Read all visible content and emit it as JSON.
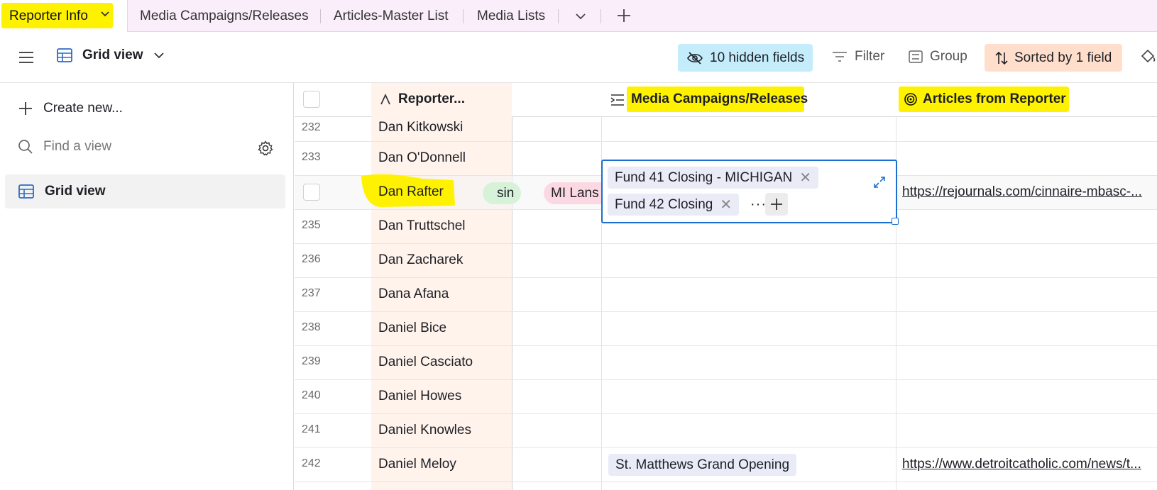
{
  "tabs": {
    "active": "Reporter Info",
    "others": [
      "Media Campaigns/Releases",
      "Articles-Master List",
      "Media Lists"
    ]
  },
  "toolbar": {
    "view_name": "Grid view",
    "hidden_fields": "10 hidden fields",
    "filter": "Filter",
    "group": "Group",
    "sorted": "Sorted by 1 field"
  },
  "sidebar": {
    "create_new": "Create new...",
    "find_placeholder": "Find a view",
    "items": [
      {
        "label": "Grid view"
      }
    ]
  },
  "grid": {
    "headers": {
      "reporter": "Reporter...",
      "media": "Media Campaigns/Releases",
      "articles": "Articles from Reporter"
    },
    "rows": [
      {
        "num": "232",
        "name": "Dan Kitkowski"
      },
      {
        "num": "233",
        "name": "Dan O'Donnell"
      },
      {
        "num": "",
        "name": "Dan Rafter",
        "chips_left": [
          "sin",
          "MI Lans"
        ],
        "media": [
          "Fund 41 Closing - MICHIGAN",
          "Fund 42 Closing"
        ],
        "link": "https://rejournals.com/cinnaire-mbasc-..."
      },
      {
        "num": "235",
        "name": "Dan Truttschel"
      },
      {
        "num": "236",
        "name": "Dan Zacharek"
      },
      {
        "num": "237",
        "name": "Dana Afana"
      },
      {
        "num": "238",
        "name": "Daniel Bice"
      },
      {
        "num": "239",
        "name": "Daniel Casciato"
      },
      {
        "num": "240",
        "name": "Daniel Howes"
      },
      {
        "num": "241",
        "name": "Daniel Knowles"
      },
      {
        "num": "242",
        "name": "Daniel Meloy",
        "media": [
          "St. Matthews Grand Opening"
        ],
        "link": "https://www.detroitcatholic.com/news/t..."
      }
    ]
  },
  "colors": {
    "highlight": "#fff200",
    "hidden_fields_bg": "#c4ecfb",
    "sorted_bg": "#ffdfcc",
    "name_col_bg": "#fff3ec",
    "selection_border": "#1a6fd1"
  }
}
